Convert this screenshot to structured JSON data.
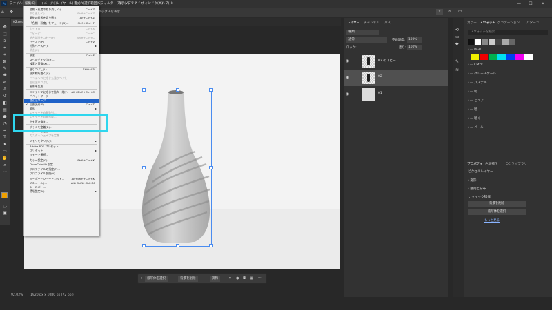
{
  "menubar": {
    "logo": "Ps",
    "items": [
      "ファイル(F)",
      "編集(E)",
      "イメージ(I)",
      "レイヤー(L)",
      "書式(Y)",
      "選択範囲(S)",
      "フィルター(T)",
      "表示(V)",
      "プラグイン",
      "ウィンドウ(W)",
      "ヘルプ(H)"
    ],
    "active_index": 1,
    "window_controls": [
      "—",
      "☐",
      "✕"
    ]
  },
  "options_bar": {
    "text": "ボックスを表示"
  },
  "document_tab": {
    "label": "02.psd"
  },
  "edit_menu": {
    "items": [
      {
        "label": "色相・彩度の取り消し(O)",
        "shortcut": "Ctrl+Z",
        "disabled": false
      },
      {
        "label": "やり直し(O)",
        "shortcut": "Shift+Ctrl+Z",
        "disabled": true
      },
      {
        "label": "最後の状態を切り替え",
        "shortcut": "Alt+Ctrl+Z",
        "disabled": false
      },
      {
        "sep": true
      },
      {
        "label": "「色相・彩度」をフェード(D)...",
        "shortcut": "Shift+Ctrl+F",
        "disabled": false
      },
      {
        "sep": true
      },
      {
        "label": "カット(T)",
        "shortcut": "Ctrl+X",
        "disabled": true
      },
      {
        "label": "コピー(C)",
        "shortcut": "Ctrl+C",
        "disabled": true
      },
      {
        "label": "結合部分をコピー(Y)",
        "shortcut": "Shift+Ctrl+C",
        "disabled": true
      },
      {
        "label": "ペースト(P)",
        "shortcut": "Ctrl+V",
        "disabled": false
      },
      {
        "label": "特殊ペースト(I)",
        "shortcut": "",
        "disabled": false,
        "submenu": true
      },
      {
        "label": "消去(E)",
        "shortcut": "",
        "disabled": true
      },
      {
        "sep": true
      },
      {
        "label": "検索",
        "shortcut": "Ctrl+F",
        "disabled": false
      },
      {
        "label": "スペルチェック(H)...",
        "shortcut": "",
        "disabled": false
      },
      {
        "label": "検索と置換(X)...",
        "shortcut": "",
        "disabled": false
      },
      {
        "sep": true
      },
      {
        "label": "塗りつぶし(L)...",
        "shortcut": "Shift+F5",
        "disabled": false
      },
      {
        "label": "境界線を描く(S)...",
        "shortcut": "",
        "disabled": false
      },
      {
        "label": "コンテンツに応じた塗りつぶし...",
        "shortcut": "",
        "disabled": true
      },
      {
        "label": "生成塗りつぶし...",
        "shortcut": "",
        "disabled": true
      },
      {
        "label": "画像を生成...",
        "shortcut": "",
        "disabled": false
      },
      {
        "sep": true
      },
      {
        "label": "コンテンツに応じて拡大・縮小",
        "shortcut": "Alt+Shift+Ctrl+C",
        "disabled": false
      },
      {
        "label": "パペットワープ",
        "shortcut": "",
        "disabled": false
      },
      {
        "label": "遠近法ワープ",
        "shortcut": "",
        "disabled": false,
        "highlight": true
      },
      {
        "label": "自由変形(F)",
        "shortcut": "Ctrl+T",
        "disabled": false,
        "checked": true
      },
      {
        "label": "変形",
        "shortcut": "",
        "disabled": false,
        "submenu": true
      },
      {
        "label": "レイヤーを自動整列...",
        "shortcut": "",
        "disabled": true
      },
      {
        "label": "レイヤーを自動合成...",
        "shortcut": "",
        "disabled": true
      },
      {
        "label": "空を置き換え...",
        "shortcut": "",
        "disabled": false
      },
      {
        "sep": true
      },
      {
        "label": "ブラシを定義(B)...",
        "shortcut": "",
        "disabled": false
      },
      {
        "label": "パターンを定義...",
        "shortcut": "",
        "disabled": false
      },
      {
        "label": "カスタムシェイプを定義...",
        "shortcut": "",
        "disabled": true
      },
      {
        "sep": true
      },
      {
        "label": "メモリをクリア(R)",
        "shortcut": "",
        "disabled": false,
        "submenu": true
      },
      {
        "sep": true
      },
      {
        "label": "Adobe PDF プリセット...",
        "shortcut": "",
        "disabled": false
      },
      {
        "label": "プリセット",
        "shortcut": "",
        "disabled": false,
        "submenu": true
      },
      {
        "label": "リモート接続...",
        "shortcut": "",
        "disabled": false
      },
      {
        "sep": true
      },
      {
        "label": "カラー設定(G)...",
        "shortcut": "Shift+Ctrl+K",
        "disabled": false
      },
      {
        "label": "OpenColorIO 設定...",
        "shortcut": "",
        "disabled": false
      },
      {
        "label": "プロファイルの指定(P)...",
        "shortcut": "",
        "disabled": false
      },
      {
        "label": "プロファイル変換(V)...",
        "shortcut": "",
        "disabled": false
      },
      {
        "sep": true
      },
      {
        "label": "キーボードショートカット...",
        "shortcut": "Alt+Shift+Ctrl+K",
        "disabled": false
      },
      {
        "label": "メニュー(U)...",
        "shortcut": "Alt+Shift+Ctrl+M",
        "disabled": false
      },
      {
        "label": "ツールバー...",
        "shortcut": "",
        "disabled": false
      },
      {
        "label": "環境設定(N)",
        "shortcut": "",
        "disabled": false,
        "submenu": true
      }
    ]
  },
  "taskbar": {
    "select_subject": "被写体を選択",
    "remove_bg": "背景を削除",
    "adjust": "調和"
  },
  "status_bar": {
    "zoom": "92.02%",
    "doc_info": "1920 px x 1080 px (72 ppi)"
  },
  "layers_panel": {
    "tabs": [
      "レイヤー",
      "チャンネル",
      "パス"
    ],
    "kind": "種類",
    "blend_mode": "通常",
    "opacity_label": "不透明度:",
    "opacity_value": "100%",
    "lock_label": "ロック:",
    "fill_label": "塗り:",
    "fill_value": "100%",
    "layers": [
      {
        "name": "02 のコピー"
      },
      {
        "name": "02"
      },
      {
        "name": "01"
      }
    ],
    "selected_index": 1
  },
  "swatches_panel": {
    "tabs": [
      "カラー",
      "スウォッチ",
      "グラデーション",
      "パターン"
    ],
    "search_placeholder": "スウォッチを検索",
    "folders": [
      "RGB",
      "CMYK",
      "グレースケール",
      "パステル",
      "明",
      "ピュア",
      "暗",
      "暗く",
      "ペール"
    ],
    "colors": [
      "#f0f000",
      "#f00000",
      "#00b050",
      "#00e0f0",
      "#0040f0",
      "#f000f0",
      "#ffffff"
    ],
    "recent_colors": [
      "#111111",
      "#ffffff",
      "#888888",
      "#cccccc",
      "#444444",
      "#aaaaaa",
      "#666666"
    ]
  },
  "properties_panel": {
    "tabs": [
      "プロパティ",
      "色調補正",
      "CC ライブラリ"
    ],
    "layer_type": "ピクセルレイヤー",
    "sections": [
      "変形",
      "整列と分布",
      "クイック操作"
    ],
    "buttons": [
      "背景を削除",
      "被写体を選択"
    ],
    "link": "もっと見る"
  },
  "foreground_color": "#f0a000"
}
